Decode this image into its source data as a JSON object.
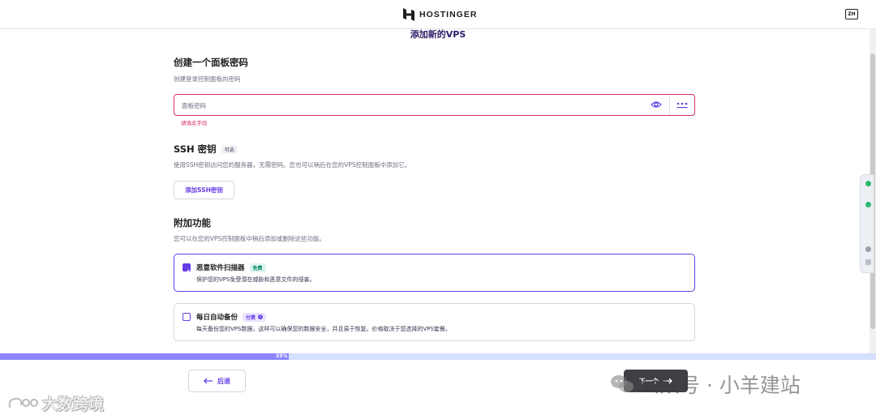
{
  "header": {
    "brand": "HOSTINGER",
    "language": "ZH"
  },
  "page": {
    "title": "添加新的VPS"
  },
  "panel_password": {
    "heading": "创建一个面板密码",
    "subtitle": "创建登录控制面板的密码",
    "placeholder": "面板密码",
    "error": "请填此字段"
  },
  "ssh": {
    "heading": "SSH 密钥",
    "optional_badge": "可选",
    "description": "使用SSH密钥访问您的服务器，无需密码。您也可以稍后在您的VPS控制面板中添加它。",
    "button": "添加SSH密钥"
  },
  "addons": {
    "heading": "附加功能",
    "description": "您可以在您的VPS控制面板中稍后添加或删除这些功能。",
    "items": [
      {
        "title": "恶意软件扫描器",
        "badge": "免费",
        "description": "保护您的VPS免受潜在威胁和恶意文件的侵害。",
        "checked": true
      },
      {
        "title": "每日自动备份",
        "badge": "付费",
        "description": "每天备份您的VPS数据，这样可以确保您的数据安全，并且易于恢复。价格取决于您选择的VPS套餐。",
        "checked": false
      }
    ]
  },
  "progress": {
    "label": "33%",
    "value": 0.33
  },
  "nav": {
    "back": "后退",
    "next": "下一个"
  },
  "watermarks": {
    "left": "大数跨境",
    "right": "公众号 · 小羊建站"
  },
  "colors": {
    "accent": "#673de6",
    "error": "#d63163",
    "free": "#008361",
    "progress": "#8c85ff"
  }
}
